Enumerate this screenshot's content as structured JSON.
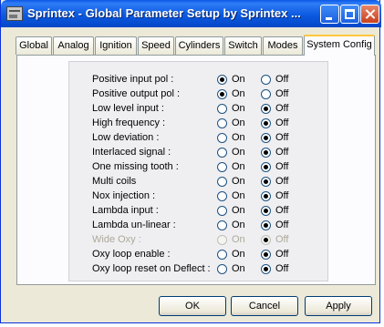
{
  "window": {
    "title": "Sprintex - Global Parameter Setup   by Sprintex ..."
  },
  "tabs": [
    {
      "label": "Global"
    },
    {
      "label": "Analog"
    },
    {
      "label": "Ignition"
    },
    {
      "label": "Speed"
    },
    {
      "label": "Cylinders"
    },
    {
      "label": "Switch"
    },
    {
      "label": "Modes"
    },
    {
      "label": "System Config",
      "active": true
    }
  ],
  "options": {
    "on_label": "On",
    "off_label": "Off",
    "rows": [
      {
        "label": "Positive input pol :",
        "value": "On"
      },
      {
        "label": "Positive output pol :",
        "value": "On"
      },
      {
        "label": "Low level input :",
        "value": "Off"
      },
      {
        "label": "High frequency :",
        "value": "Off"
      },
      {
        "label": "Low deviation :",
        "value": "Off"
      },
      {
        "label": "Interlaced signal :",
        "value": "Off"
      },
      {
        "label": "One missing tooth :",
        "value": "Off"
      },
      {
        "label": "Multi coils",
        "value": "Off"
      },
      {
        "label": "Nox injection :",
        "value": "Off"
      },
      {
        "label": "Lambda input :",
        "value": "Off"
      },
      {
        "label": "Lambda un-linear :",
        "value": "Off"
      },
      {
        "label": "Wide Oxy :",
        "value": "Off",
        "disabled": true
      },
      {
        "label": "Oxy loop enable :",
        "value": "Off"
      },
      {
        "label": "Oxy loop reset on Deflect :",
        "value": "Off"
      }
    ]
  },
  "buttons": {
    "ok_label": "OK",
    "cancel_label": "Cancel",
    "apply_label": "Apply"
  }
}
